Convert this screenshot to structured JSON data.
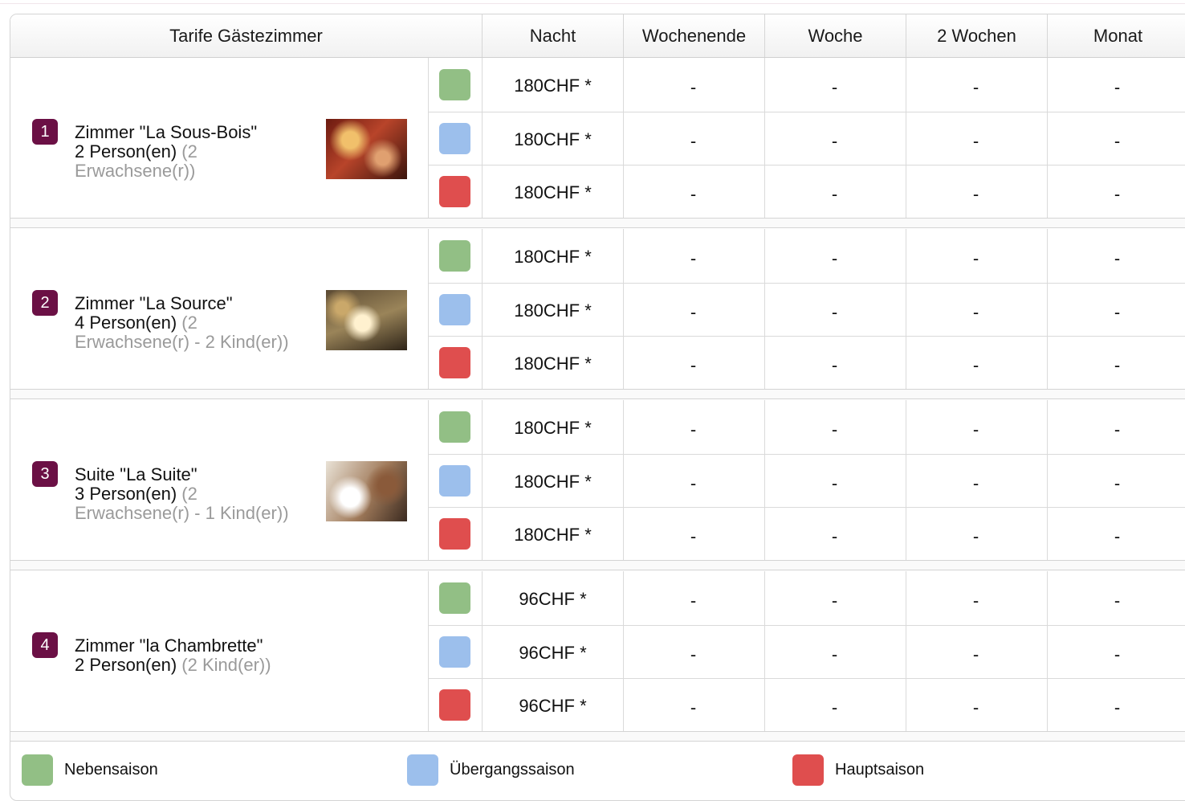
{
  "table": {
    "headers": [
      "Tarife Gästezimmer",
      "Nacht",
      "Wochenende",
      "Woche",
      "2 Wochen",
      "Monat"
    ],
    "rooms": [
      {
        "number": "1",
        "name": "Zimmer \"La Sous-Bois\"",
        "persons": "2 Person(en)",
        "detail": "(2 Erwachsene(r))",
        "photo": "Zimmer \"La Sous-Bois\"",
        "rates": [
          {
            "season": "Nebensaison",
            "nacht": "180CHF *",
            "wochenende": "-",
            "woche": "-",
            "zwei_wochen": "-",
            "monat": "-"
          },
          {
            "season": "Übergangssaison",
            "nacht": "180CHF *",
            "wochenende": "-",
            "woche": "-",
            "zwei_wochen": "-",
            "monat": "-"
          },
          {
            "season": "Hauptsaison",
            "nacht": "180CHF *",
            "wochenende": "-",
            "woche": "-",
            "zwei_wochen": "-",
            "monat": "-"
          }
        ]
      },
      {
        "number": "2",
        "name": "Zimmer \"La Source\"",
        "persons": "4 Person(en)",
        "detail": "(2 Erwachsene(r) - 2 Kind(er))",
        "photo": "Zimmer \"La Source\"",
        "rates": [
          {
            "season": "Nebensaison",
            "nacht": "180CHF *",
            "wochenende": "-",
            "woche": "-",
            "zwei_wochen": "-",
            "monat": "-"
          },
          {
            "season": "Übergangssaison",
            "nacht": "180CHF *",
            "wochenende": "-",
            "woche": "-",
            "zwei_wochen": "-",
            "monat": "-"
          },
          {
            "season": "Hauptsaison",
            "nacht": "180CHF *",
            "wochenende": "-",
            "woche": "-",
            "zwei_wochen": "-",
            "monat": "-"
          }
        ]
      },
      {
        "number": "3",
        "name": "Suite \"La Suite\"",
        "persons": "3 Person(en)",
        "detail": "(2 Erwachsene(r) - 1 Kind(er))",
        "photo": "Suite \"La Suite\"",
        "rates": [
          {
            "season": "Nebensaison",
            "nacht": "180CHF *",
            "wochenende": "-",
            "woche": "-",
            "zwei_wochen": "-",
            "monat": "-"
          },
          {
            "season": "Übergangssaison",
            "nacht": "180CHF *",
            "wochenende": "-",
            "woche": "-",
            "zwei_wochen": "-",
            "monat": "-"
          },
          {
            "season": "Hauptsaison",
            "nacht": "180CHF *",
            "wochenende": "-",
            "woche": "-",
            "zwei_wochen": "-",
            "monat": "-"
          }
        ]
      },
      {
        "number": "4",
        "name": "Zimmer \"la Chambrette\"",
        "persons": "2 Person(en)",
        "detail": "(2 Kind(er))",
        "photo": null,
        "rates": [
          {
            "season": "Nebensaison",
            "nacht": "96CHF *",
            "wochenende": "-",
            "woche": "-",
            "zwei_wochen": "-",
            "monat": "-"
          },
          {
            "season": "Übergangssaison",
            "nacht": "96CHF *",
            "wochenende": "-",
            "woche": "-",
            "zwei_wochen": "-",
            "monat": "-"
          },
          {
            "season": "Hauptsaison",
            "nacht": "96CHF *",
            "wochenende": "-",
            "woche": "-",
            "zwei_wochen": "-",
            "monat": "-"
          }
        ]
      }
    ]
  },
  "legend": [
    {
      "label": "Nebensaison",
      "color": "#92bf85"
    },
    {
      "label": "Übergangssaison",
      "color": "#9cbfec"
    },
    {
      "label": "Hauptsaison",
      "color": "#df4e4e"
    }
  ]
}
